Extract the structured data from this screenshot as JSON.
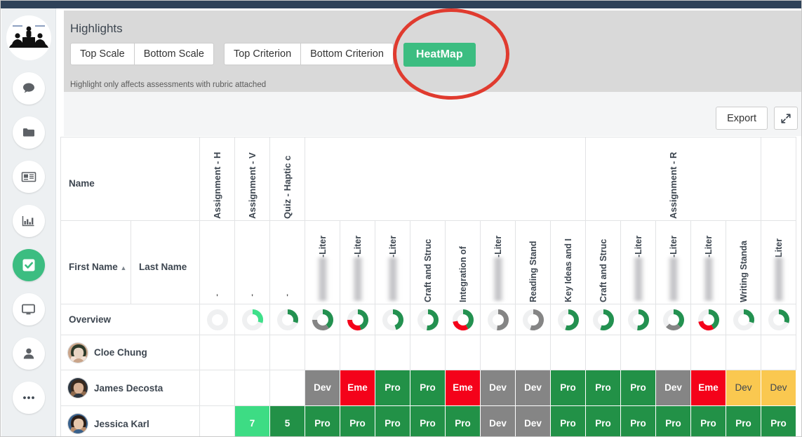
{
  "topbar": {
    "accent_color": "#2f4259"
  },
  "sidebar": {
    "logo_name": "classroom-logo",
    "items": [
      {
        "name": "messages",
        "icon": "chat-bubble-icon",
        "active": false
      },
      {
        "name": "files",
        "icon": "folder-icon",
        "active": false
      },
      {
        "name": "news",
        "icon": "newspaper-icon",
        "active": false
      },
      {
        "name": "reports",
        "icon": "bar-chart-icon",
        "active": false
      },
      {
        "name": "assessments",
        "icon": "checkbox-icon",
        "active": true
      },
      {
        "name": "display",
        "icon": "monitor-icon",
        "active": false
      },
      {
        "name": "profile",
        "icon": "person-icon",
        "active": false
      },
      {
        "name": "more",
        "icon": "ellipsis-icon",
        "active": false
      }
    ],
    "active_color": "#3cbd81"
  },
  "highlights": {
    "title": "Highlights",
    "scale_group": [
      "Top Scale",
      "Bottom Scale"
    ],
    "criterion_group": [
      "Top Criterion",
      "Bottom Criterion"
    ],
    "heatmap_label": "HeatMap",
    "heatmap_active": true,
    "note": "Highlight only affects assessments with rubric attached"
  },
  "toolbar": {
    "export_label": "Export",
    "expand_icon": "expand-arrows-icon"
  },
  "annotation": {
    "shape": "circle",
    "color": "#e03b2f",
    "target": "HeatMap"
  },
  "grid": {
    "name_header": "Name",
    "first_name_header": "First Name",
    "last_name_header": "Last Name",
    "sort_caret": "▲",
    "overview_label": "Overview",
    "assignment_headers": [
      {
        "label": "Assignment - H",
        "span": 1
      },
      {
        "label": "Assignment - V",
        "span": 1
      },
      {
        "label": "Quiz - Haptic c",
        "span": 1
      },
      {
        "label": "",
        "span": 8
      },
      {
        "label": "Assignment - R",
        "span": 5
      },
      {
        "label": "",
        "span": 2
      }
    ],
    "criterion_headers": [
      {
        "label": "",
        "blurred": false,
        "tick": "'"
      },
      {
        "label": "",
        "blurred": false,
        "tick": "'"
      },
      {
        "label": "",
        "blurred": false,
        "tick": "'"
      },
      {
        "label": "-Liter",
        "blurred": true
      },
      {
        "label": "-Liter",
        "blurred": true
      },
      {
        "label": "-Liter",
        "blurred": true
      },
      {
        "label": "Craft and Struc",
        "blurred": false
      },
      {
        "label": "Integration of",
        "blurred": false
      },
      {
        "label": "-Liter",
        "blurred": true
      },
      {
        "label": "Reading Stand",
        "blurred": false
      },
      {
        "label": "Key Ideas and I",
        "blurred": false
      },
      {
        "label": "Craft and Struc",
        "blurred": false
      },
      {
        "label": "-Liter",
        "blurred": true
      },
      {
        "label": "-Liter",
        "blurred": true
      },
      {
        "label": "-Liter",
        "blurred": true
      },
      {
        "label": "Writing Standa",
        "blurred": false
      },
      {
        "label": "Liter",
        "blurred": true
      }
    ],
    "overview_donuts": [
      {
        "green": 0,
        "red": 0,
        "gray": 0
      },
      {
        "green": 30,
        "red": 0,
        "gray": 0,
        "shade": "light"
      },
      {
        "green": 30,
        "red": 0,
        "gray": 0
      },
      {
        "green": 40,
        "red": 0,
        "gray": 35
      },
      {
        "green": 45,
        "red": 30,
        "gray": 0
      },
      {
        "green": 45,
        "red": 0,
        "gray": 0
      },
      {
        "green": 52,
        "red": 0,
        "gray": 0
      },
      {
        "green": 42,
        "red": 30,
        "gray": 0
      },
      {
        "green": 0,
        "red": 0,
        "gray": 52
      },
      {
        "green": 0,
        "red": 0,
        "gray": 55
      },
      {
        "green": 55,
        "red": 0,
        "gray": 0
      },
      {
        "green": 55,
        "red": 0,
        "gray": 0
      },
      {
        "green": 52,
        "red": 0,
        "gray": 0
      },
      {
        "green": 38,
        "red": 0,
        "gray": 25
      },
      {
        "green": 42,
        "red": 30,
        "gray": 0
      },
      {
        "green": 30,
        "red": 0,
        "gray": 0
      },
      {
        "green": 30,
        "red": 0,
        "gray": 0
      }
    ],
    "students": [
      {
        "name": "Cloe Chung",
        "avatar": "photo-female-1",
        "cells": [
          {
            "v": "",
            "c": "none"
          },
          {
            "v": "",
            "c": "none"
          },
          {
            "v": "",
            "c": "none"
          },
          {
            "v": "",
            "c": "none"
          },
          {
            "v": "",
            "c": "none"
          },
          {
            "v": "",
            "c": "none"
          },
          {
            "v": "",
            "c": "none"
          },
          {
            "v": "",
            "c": "none"
          },
          {
            "v": "",
            "c": "none"
          },
          {
            "v": "",
            "c": "none"
          },
          {
            "v": "",
            "c": "none"
          },
          {
            "v": "",
            "c": "none"
          },
          {
            "v": "",
            "c": "none"
          },
          {
            "v": "",
            "c": "none"
          },
          {
            "v": "",
            "c": "none"
          },
          {
            "v": "",
            "c": "none"
          },
          {
            "v": "",
            "c": "none"
          }
        ]
      },
      {
        "name": "James Decosta",
        "avatar": "photo-male-1",
        "cells": [
          {
            "v": "",
            "c": "none"
          },
          {
            "v": "",
            "c": "none"
          },
          {
            "v": "",
            "c": "none"
          },
          {
            "v": "Dev",
            "c": "gray"
          },
          {
            "v": "Eme",
            "c": "red"
          },
          {
            "v": "Pro",
            "c": "green"
          },
          {
            "v": "Pro",
            "c": "green"
          },
          {
            "v": "Eme",
            "c": "red"
          },
          {
            "v": "Dev",
            "c": "gray"
          },
          {
            "v": "Dev",
            "c": "gray"
          },
          {
            "v": "Pro",
            "c": "green"
          },
          {
            "v": "Pro",
            "c": "green"
          },
          {
            "v": "Pro",
            "c": "green"
          },
          {
            "v": "Dev",
            "c": "gray"
          },
          {
            "v": "Eme",
            "c": "red"
          },
          {
            "v": "Dev",
            "c": "yellow"
          },
          {
            "v": "Dev",
            "c": "yellow"
          }
        ]
      },
      {
        "name": "Jessica Karl",
        "avatar": "photo-female-2",
        "cells": [
          {
            "v": "",
            "c": "none"
          },
          {
            "v": "7",
            "c": "lightgreen"
          },
          {
            "v": "5",
            "c": "green"
          },
          {
            "v": "Pro",
            "c": "green"
          },
          {
            "v": "Pro",
            "c": "green"
          },
          {
            "v": "Pro",
            "c": "green"
          },
          {
            "v": "Pro",
            "c": "green"
          },
          {
            "v": "Pro",
            "c": "green"
          },
          {
            "v": "Dev",
            "c": "gray"
          },
          {
            "v": "Dev",
            "c": "gray"
          },
          {
            "v": "Pro",
            "c": "green"
          },
          {
            "v": "Pro",
            "c": "green"
          },
          {
            "v": "Pro",
            "c": "green"
          },
          {
            "v": "Pro",
            "c": "green"
          },
          {
            "v": "Pro",
            "c": "green"
          },
          {
            "v": "Pro",
            "c": "green"
          },
          {
            "v": "Pro",
            "c": "green"
          }
        ]
      }
    ],
    "colors": {
      "green": "#229147",
      "lightgreen": "#3ddc84",
      "red": "#f4021a",
      "gray": "#858585",
      "yellow": "#fac850",
      "donut_track": "#eff0f1",
      "donut_green": "#239150",
      "donut_lightgreen": "#3fe08a",
      "donut_red": "#f4021a",
      "donut_gray": "#858585"
    }
  }
}
